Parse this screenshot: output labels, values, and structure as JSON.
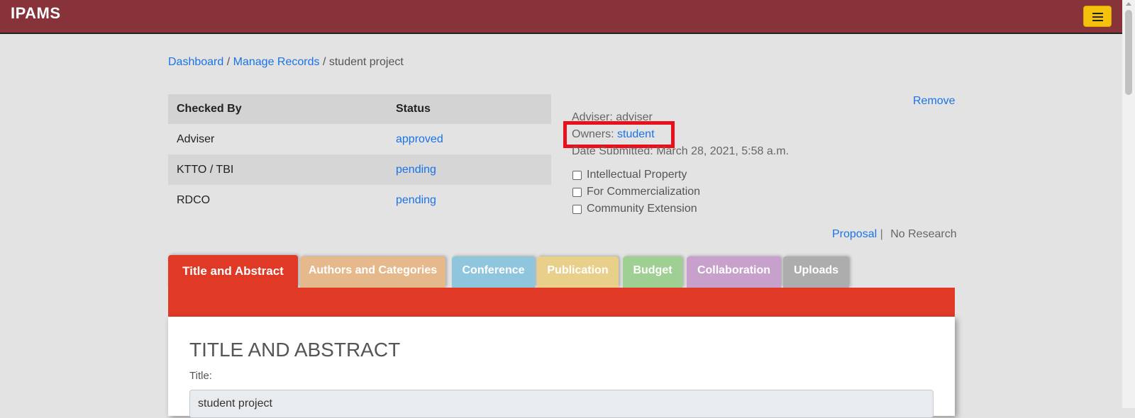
{
  "navbar": {
    "brand": "IPAMS"
  },
  "breadcrumb": {
    "items": [
      "Dashboard",
      "Manage Records"
    ],
    "separator": "/",
    "current": "student project"
  },
  "checks_table": {
    "headers": [
      "Checked By",
      "Status"
    ],
    "rows": [
      {
        "by": "Adviser",
        "status": "approved"
      },
      {
        "by": "KTTO / TBI",
        "status": "pending"
      },
      {
        "by": "RDCO",
        "status": "pending"
      }
    ]
  },
  "record_info": {
    "adviser_label": "Adviser:",
    "adviser_value": "adviser",
    "owners_label": "Owners:",
    "owners_value": "student",
    "date_label": "Date Submitted:",
    "date_value": "March 28, 2021, 5:58 a.m.",
    "remove_label": "Remove",
    "checkboxes": [
      "Intellectual Property",
      "For Commercialization",
      "Community Extension"
    ],
    "proposal_label": "Proposal",
    "pipe": "|",
    "no_research_label": "No Research"
  },
  "tabs": [
    {
      "label": "Title and Abstract",
      "color": "#e03a27",
      "active": true
    },
    {
      "label": "Authors and Categories",
      "color": "#e5b98c"
    },
    {
      "label": "Conference",
      "color": "#8fc6de"
    },
    {
      "label": "Publication",
      "color": "#e8cf8a"
    },
    {
      "label": "Budget",
      "color": "#9fcf93"
    },
    {
      "label": "Collaboration",
      "color": "#c7a1cc"
    },
    {
      "label": "Uploads",
      "color": "#adadad"
    }
  ],
  "panel": {
    "heading": "TITLE AND ABSTRACT",
    "title_label": "Title:",
    "title_value": "student project"
  },
  "colors": {
    "navbar": "#88323a",
    "accent": "#f4c20d",
    "link": "#1a73e8",
    "highlight": "#e8111b"
  }
}
